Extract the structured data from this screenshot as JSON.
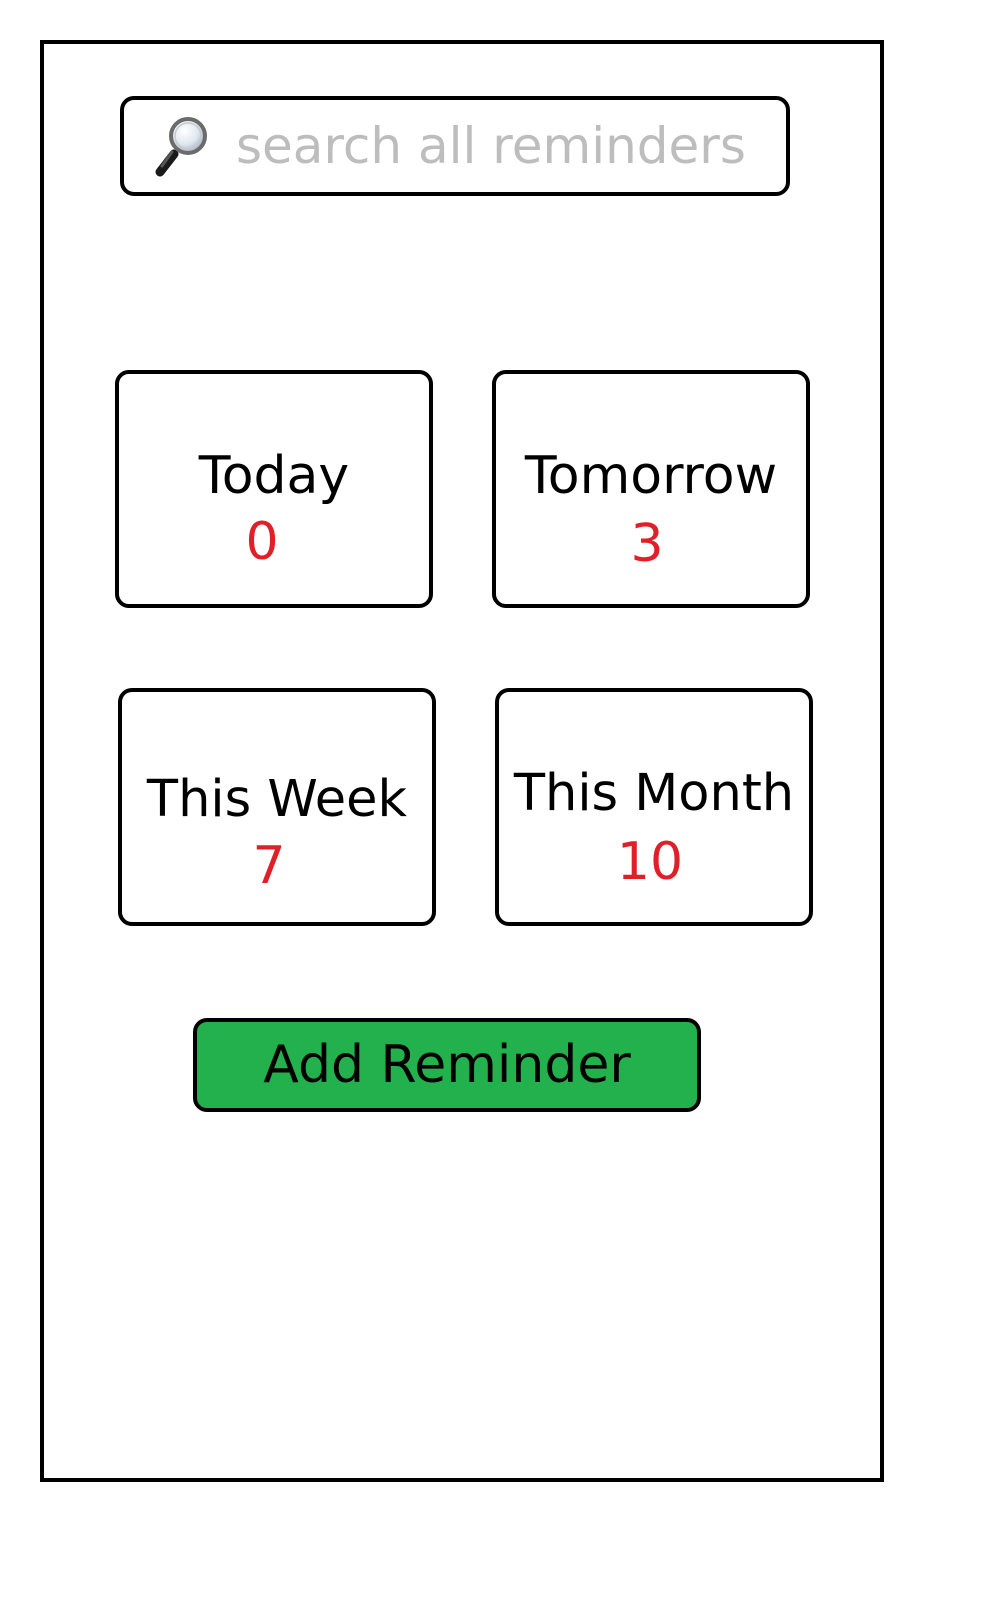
{
  "search": {
    "placeholder": "search all reminders",
    "value": "",
    "icon": "magnifier-icon"
  },
  "tiles": [
    {
      "label": "Today",
      "count": "0"
    },
    {
      "label": "Tomorrow",
      "count": "3"
    },
    {
      "label": "This Week",
      "count": "7"
    },
    {
      "label": "This Month",
      "count": "10"
    }
  ],
  "actions": {
    "add_label": "Add Reminder"
  },
  "colors": {
    "count": "#e02028",
    "add_button": "#22b14c",
    "placeholder": "#bdbdbd"
  }
}
